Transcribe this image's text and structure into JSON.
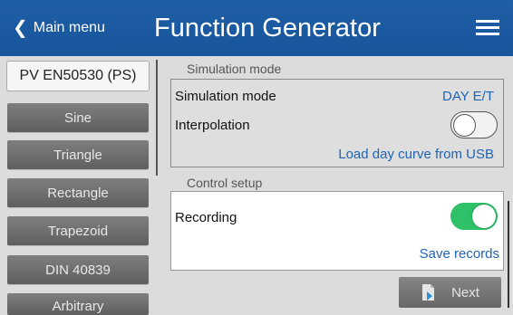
{
  "header": {
    "back_label": "Main menu",
    "title": "Function Generator",
    "menu_icon": "hamburger-menu-icon"
  },
  "sidebar": {
    "items": [
      {
        "label": "PV EN50530 (PS)",
        "active": true
      },
      {
        "label": "Sine",
        "active": false
      },
      {
        "label": "Triangle",
        "active": false
      },
      {
        "label": "Rectangle",
        "active": false
      },
      {
        "label": "Trapezoid",
        "active": false
      },
      {
        "label": "DIN 40839",
        "active": false
      },
      {
        "label": "Arbitrary",
        "active": false
      }
    ]
  },
  "simulation": {
    "section_label": "Simulation mode",
    "mode_label": "Simulation mode",
    "mode_value": "DAY E/T",
    "interpolation_label": "Interpolation",
    "interpolation_on": false,
    "load_link": "Load day curve from USB"
  },
  "control": {
    "section_label": "Control setup",
    "recording_label": "Recording",
    "recording_on": true,
    "save_link": "Save records"
  },
  "footer": {
    "next_label": "Next"
  },
  "colors": {
    "header_blue": "#1b5aa0",
    "link_blue": "#1f64b4",
    "toggle_on": "#2ec167"
  }
}
